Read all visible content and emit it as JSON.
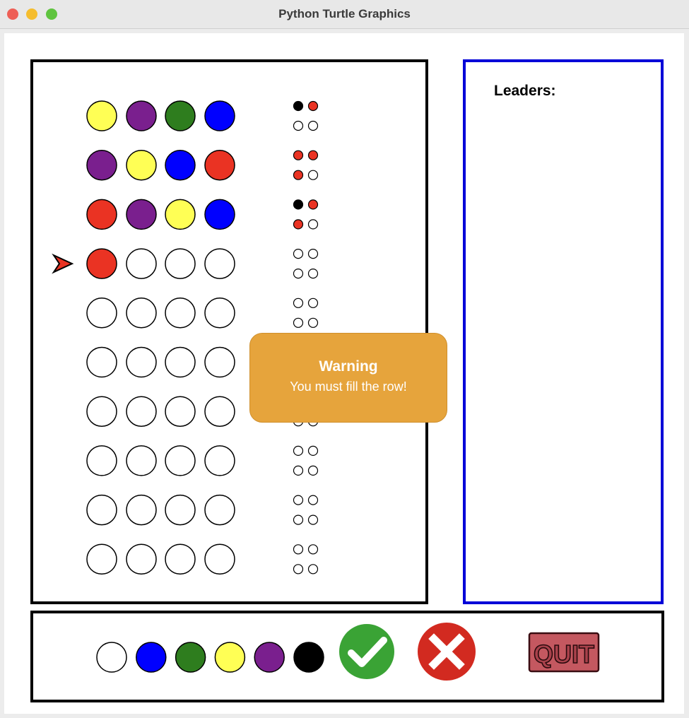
{
  "window": {
    "title": "Python Turtle Graphics"
  },
  "board": {
    "rows": [
      {
        "pegs": [
          "yellow",
          "purple",
          "green",
          "blue"
        ],
        "feedback": [
          "black",
          "red",
          "empty",
          "empty"
        ]
      },
      {
        "pegs": [
          "purple",
          "yellow",
          "blue",
          "red"
        ],
        "feedback": [
          "red",
          "red",
          "red",
          "empty"
        ]
      },
      {
        "pegs": [
          "red",
          "purple",
          "yellow",
          "blue"
        ],
        "feedback": [
          "black",
          "red",
          "red",
          "empty"
        ]
      },
      {
        "pegs": [
          "red",
          "empty",
          "empty",
          "empty"
        ],
        "feedback": [
          "empty",
          "empty",
          "empty",
          "empty"
        ]
      },
      {
        "pegs": [
          "empty",
          "empty",
          "empty",
          "empty"
        ],
        "feedback": [
          "empty",
          "empty",
          "empty",
          "empty"
        ]
      },
      {
        "pegs": [
          "empty",
          "empty",
          "empty",
          "empty"
        ],
        "feedback": [
          "empty",
          "empty",
          "empty",
          "empty"
        ]
      },
      {
        "pegs": [
          "empty",
          "empty",
          "empty",
          "empty"
        ],
        "feedback": [
          "empty",
          "empty",
          "empty",
          "empty"
        ]
      },
      {
        "pegs": [
          "empty",
          "empty",
          "empty",
          "empty"
        ],
        "feedback": [
          "empty",
          "empty",
          "empty",
          "empty"
        ]
      },
      {
        "pegs": [
          "empty",
          "empty",
          "empty",
          "empty"
        ],
        "feedback": [
          "empty",
          "empty",
          "empty",
          "empty"
        ]
      },
      {
        "pegs": [
          "empty",
          "empty",
          "empty",
          "empty"
        ],
        "feedback": [
          "empty",
          "empty",
          "empty",
          "empty"
        ]
      }
    ],
    "current_row_index": 3,
    "pointer_icon": "arrow-pointer-icon"
  },
  "leaderboard": {
    "label": "Leaders:"
  },
  "palette": {
    "colors": [
      "white",
      "blue",
      "green",
      "yellow",
      "purple",
      "black"
    ]
  },
  "controls": {
    "check_icon": "check-icon",
    "cancel_icon": "x-icon",
    "quit_label": "QUIT"
  },
  "toast": {
    "title": "Warning",
    "message": "You must fill the row!"
  },
  "colors": {
    "yellow": "#ffff55",
    "purple": "#7a1f8e",
    "green": "#2e7d1e",
    "blue": "#0000ff",
    "red": "#ea3323",
    "black": "#000000",
    "white": "#ffffff",
    "empty": "#ffffff",
    "check": "#3aa335",
    "cancel": "#d22a20",
    "quit": "#c45860",
    "leader_border": "#0000d8",
    "toast": "#e6a43c"
  }
}
